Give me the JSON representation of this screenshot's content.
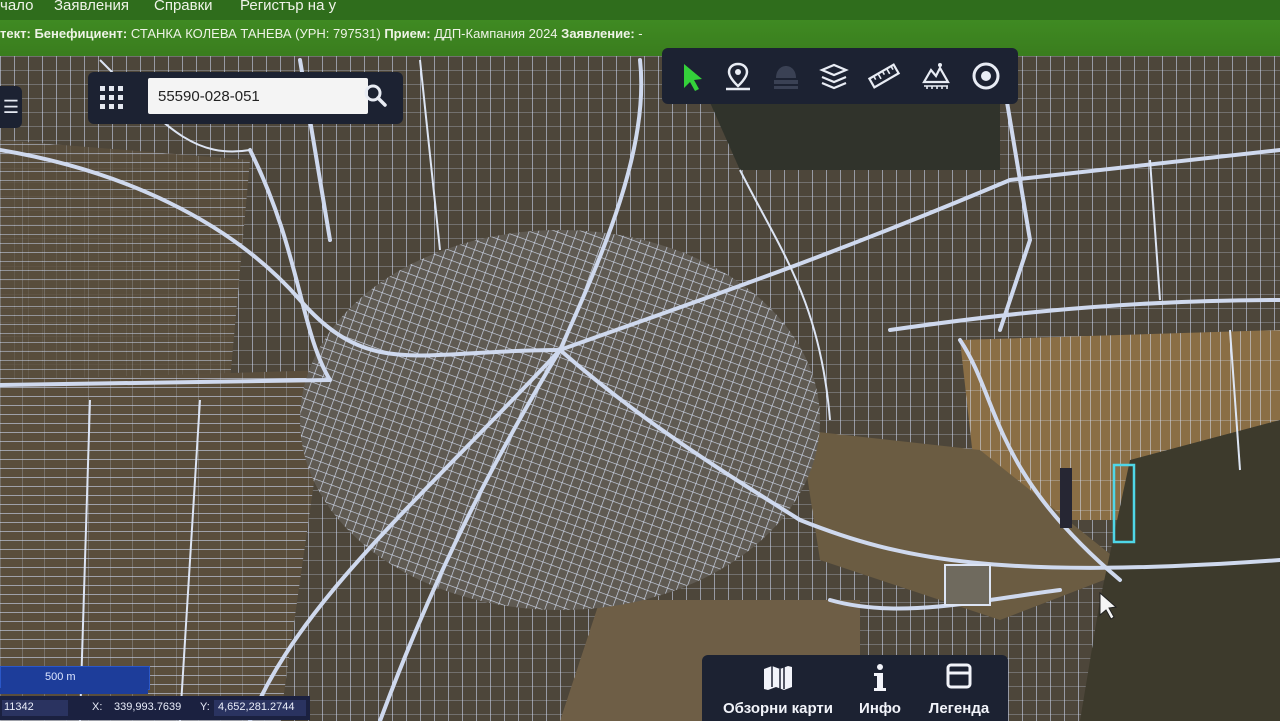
{
  "nav": {
    "items": [
      "чало",
      "Заявления",
      "Справки",
      "Регистър на у"
    ]
  },
  "context": {
    "prefix": "тект:",
    "beneficiary_label": "Бенефициент:",
    "beneficiary_value": "СТАНКА КОЛЕВА ТАНЕВА (УРН: 797531)",
    "intake_label": "Прием:",
    "intake_value": "ДДП-Кампания 2024",
    "application_label": "Заявление:",
    "application_value": "-"
  },
  "search": {
    "value": "55590-028-051"
  },
  "toolbar": {
    "tools": [
      "select-arrow-icon",
      "map-pin-icon",
      "layers-disabled-icon",
      "layers-stack-icon",
      "ruler-icon",
      "terrain-profile-icon",
      "target-icon"
    ]
  },
  "scale": {
    "label": "500 m"
  },
  "coords": {
    "epsg_partial": "11342",
    "x_label": "X:",
    "x_value": "339,993.7639",
    "y_label": "Y:",
    "y_value": "4,652,281.2744"
  },
  "bottom": {
    "overview_maps": "Обзорни карти",
    "info": "Инфо",
    "legend": "Легенда"
  },
  "colors": {
    "header_green": "#3f8a22",
    "panel_dark": "#1c2232",
    "parcel_lines": "#c4d0e8",
    "selected_parcel": "#4fd6e8",
    "active_tool": "#34d13a"
  }
}
